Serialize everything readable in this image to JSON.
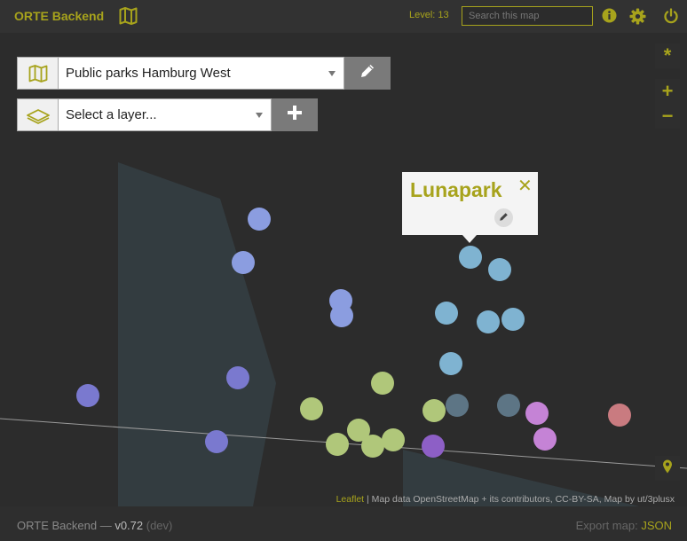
{
  "app": {
    "title": "ORTE Backend",
    "brand_icon": "map-icon"
  },
  "header": {
    "level_label": "Level: 13",
    "search_placeholder": "Search this map",
    "icons": [
      "info-icon",
      "gear-icon",
      "power-icon"
    ]
  },
  "map_selector": {
    "value": "Public parks Hamburg West",
    "icon": "map-icon",
    "edit_icon": "pencil-icon"
  },
  "layer_selector": {
    "value": "Select a layer...",
    "icon": "layers-icon",
    "add_icon": "plus-icon"
  },
  "map_controls": {
    "star": "*",
    "zoom_in": "+",
    "zoom_out": "−",
    "locate_icon": "location-pin-icon"
  },
  "popup": {
    "title": "Lunapark",
    "close": "✕",
    "edit_icon": "pencil-icon"
  },
  "attribution": {
    "link": "Leaflet",
    "text": " | Map data OpenStreetMap + its contributors, CC-BY-SA, Map by ut/3plusx"
  },
  "footer": {
    "app_name": "ORTE Backend",
    "separator": " — ",
    "version": "v0.72",
    "env": " (dev)",
    "export_label": "Export map: ",
    "export_link": "JSON"
  },
  "colors": {
    "accent": "#a7a31c",
    "marker_blue": "#7fb3d1",
    "marker_periwinkle": "#8b9de0",
    "marker_indigo": "#7a79cf",
    "marker_green": "#b0c77a",
    "marker_slate": "#5d7585",
    "marker_pink": "#c583d6",
    "marker_violet": "#8d5fc6",
    "marker_red": "#c97b80"
  }
}
